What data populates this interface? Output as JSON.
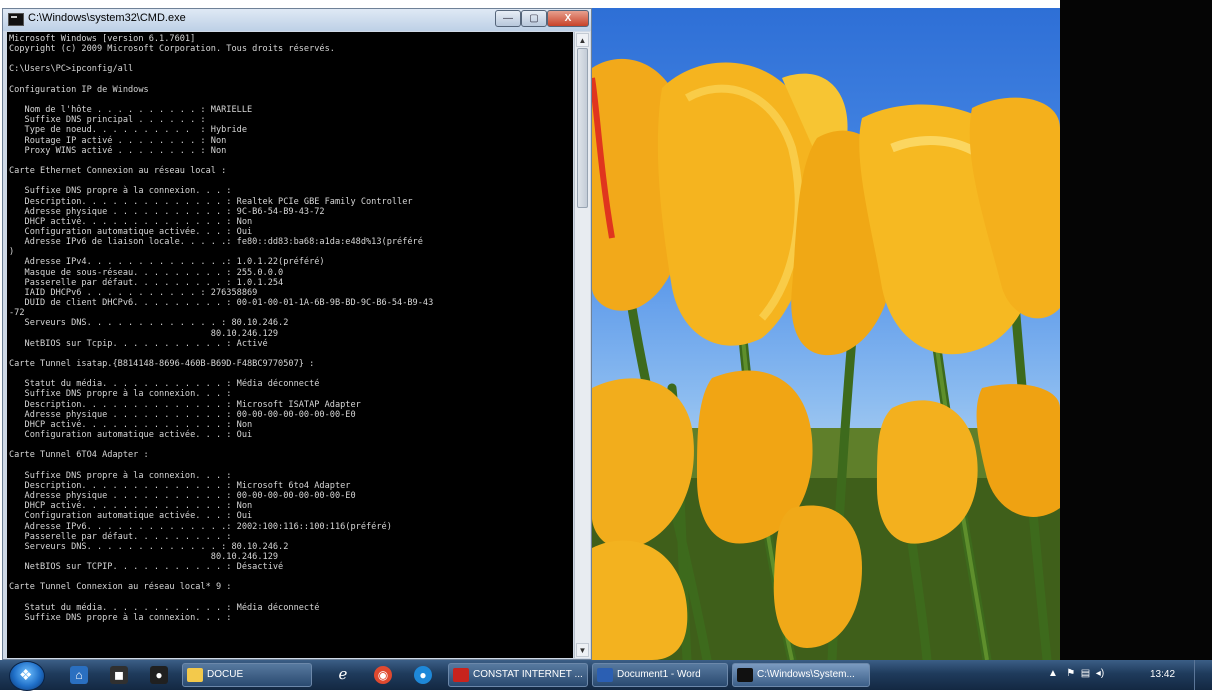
{
  "window": {
    "title": "C:\\Windows\\system32\\CMD.exe",
    "minimize": "—",
    "maximize": "▢",
    "close": "X"
  },
  "console_lines": [
    "Microsoft Windows [version 6.1.7601]",
    "Copyright (c) 2009 Microsoft Corporation. Tous droits réservés.",
    "",
    "C:\\Users\\PC>ipconfig/all",
    "",
    "Configuration IP de Windows",
    "",
    "   Nom de l'hôte . . . . . . . . . . : MARIELLE",
    "   Suffixe DNS principal . . . . . . :",
    "   Type de noeud. . . . . . . . . .  : Hybride",
    "   Routage IP activé . . . . . . . . : Non",
    "   Proxy WINS activé . . . . . . . . : Non",
    "",
    "Carte Ethernet Connexion au réseau local :",
    "",
    "   Suffixe DNS propre à la connexion. . . :",
    "   Description. . . . . . . . . . . . . . : Realtek PCIe GBE Family Controller",
    "   Adresse physique . . . . . . . . . . . : 9C-B6-54-B9-43-72",
    "   DHCP activé. . . . . . . . . . . . . . : Non",
    "   Configuration automatique activée. . . : Oui",
    "   Adresse IPv6 de liaison locale. . . . .: fe80::dd83:ba68:a1da:e48d%13(préféré",
    ")",
    "   Adresse IPv4. . . . . . . . . . . . . .: 1.0.1.22(préféré)",
    "   Masque de sous-réseau. . . . . . . . . : 255.0.0.0",
    "   Passerelle par défaut. . . . . . . . . : 1.0.1.254",
    "   IAID DHCPv6 . . . . . . . . . . . : 276358869",
    "   DUID de client DHCPv6. . . . . . . . . : 00-01-00-01-1A-6B-9B-BD-9C-B6-54-B9-43",
    "-72",
    "   Serveurs DNS. . . . . . . . . . . . . : 80.10.246.2",
    "                                       80.10.246.129",
    "   NetBIOS sur Tcpip. . . . . . . . . . . : Activé",
    "",
    "Carte Tunnel isatap.{B814148-8696-460B-B69D-F48BC9770507} :",
    "",
    "   Statut du média. . . . . . . . . . . . : Média déconnecté",
    "   Suffixe DNS propre à la connexion. . . :",
    "   Description. . . . . . . . . . . . . . : Microsoft ISATAP Adapter",
    "   Adresse physique . . . . . . . . . . . : 00-00-00-00-00-00-00-E0",
    "   DHCP activé. . . . . . . . . . . . . . : Non",
    "   Configuration automatique activée. . . : Oui",
    "",
    "Carte Tunnel 6TO4 Adapter :",
    "",
    "   Suffixe DNS propre à la connexion. . . :",
    "   Description. . . . . . . . . . . . . . : Microsoft 6to4 Adapter",
    "   Adresse physique . . . . . . . . . . . : 00-00-00-00-00-00-00-E0",
    "   DHCP activé. . . . . . . . . . . . . . : Non",
    "   Configuration automatique activée. . . : Oui",
    "   Adresse IPv6. . . . . . . . . . . . . .: 2002:100:116::100:116(préféré)",
    "   Passerelle par défaut. . . . . . . . . :",
    "   Serveurs DNS. . . . . . . . . . . . . : 80.10.246.2",
    "                                       80.10.246.129",
    "   NetBIOS sur TCPIP. . . . . . . . . . . : Désactivé",
    "",
    "Carte Tunnel Connexion au réseau local* 9 :",
    "",
    "   Statut du média. . . . . . . . . . . . : Média déconnecté",
    "   Suffixe DNS propre à la connexion. . . :"
  ],
  "taskbar": {
    "tasks": [
      {
        "label": "DOCUE",
        "icon": "folder-icon"
      },
      {
        "label": "CONSTAT INTERNET ...",
        "icon": "pdf-icon"
      },
      {
        "label": "Document1 - Word",
        "icon": "word-icon"
      },
      {
        "label": "C:\\Windows\\System...",
        "icon": "cmd-icon"
      }
    ],
    "clock": "13:42"
  },
  "colors": {
    "console_bg": "#000000",
    "console_text": "#d6d6d6",
    "taskbar": "#1f3b5c",
    "sky": "#4d8ee8",
    "tulip": "#f2b51d"
  }
}
